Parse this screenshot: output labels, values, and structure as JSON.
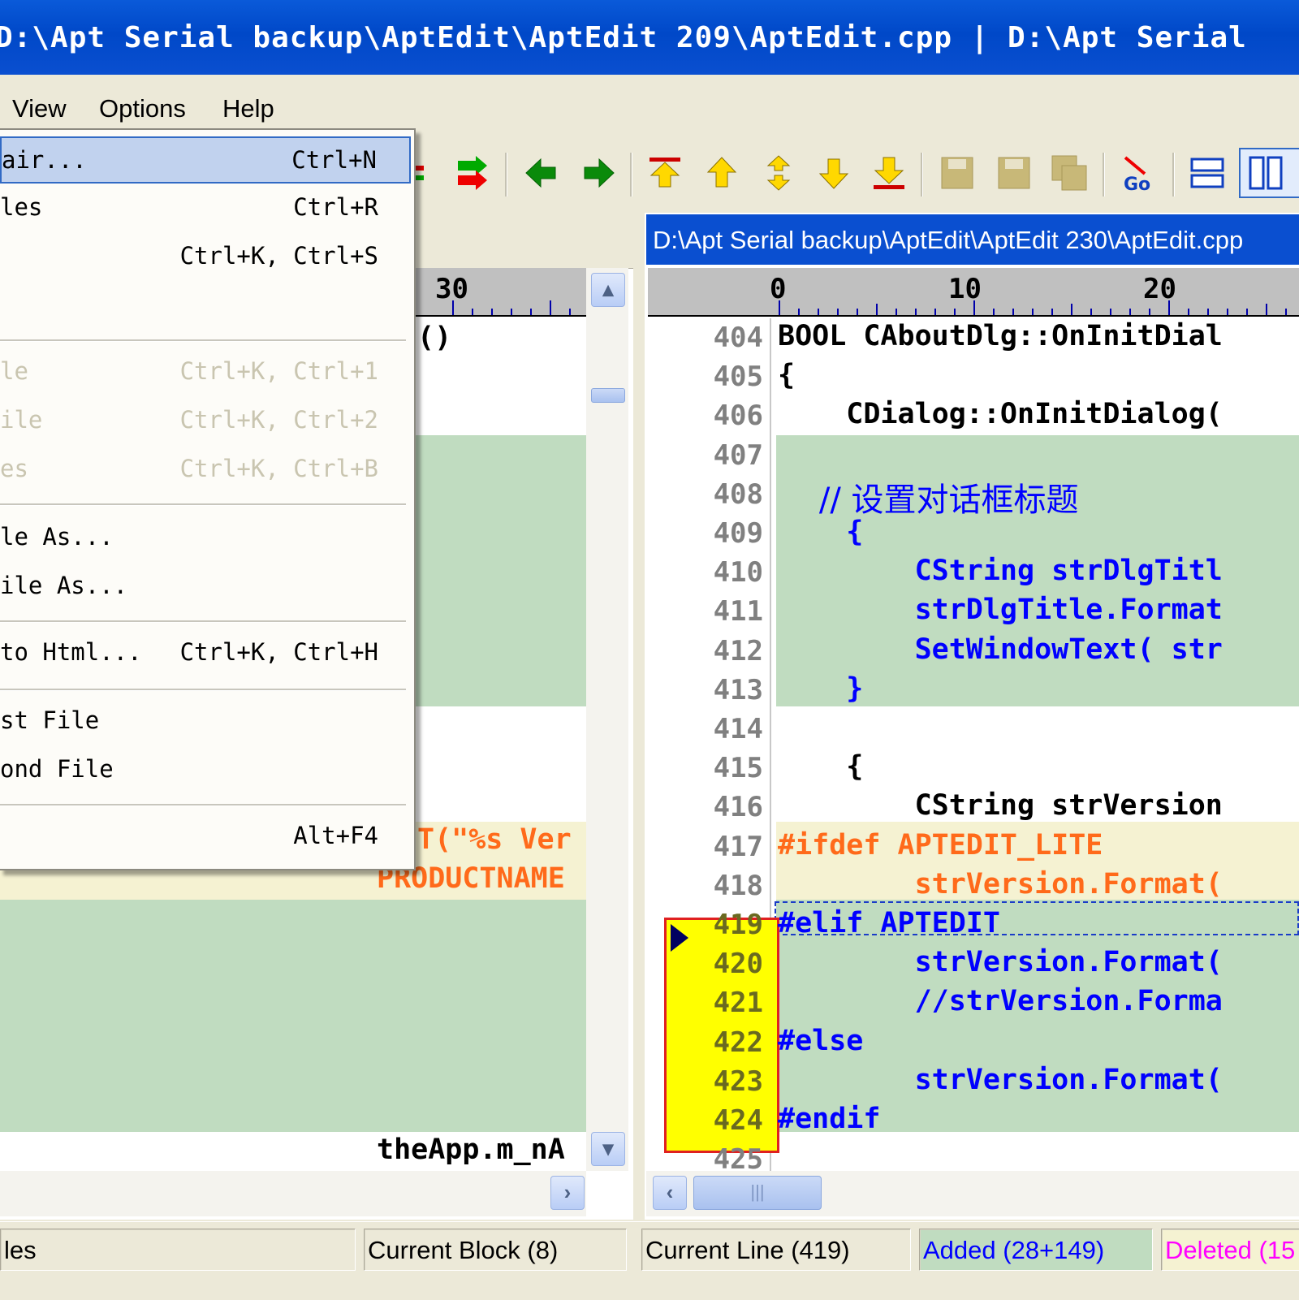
{
  "title_bar": {
    "text": "D:\\Apt Serial backup\\AptEdit\\AptEdit 209\\AptEdit.cpp | D:\\Apt Serial"
  },
  "menu": {
    "view": "View",
    "options": "Options",
    "help": "Help"
  },
  "dropdown": {
    "items": [
      {
        "label": "air...",
        "shortcut": "Ctrl+N",
        "enabled": true,
        "selected": true
      },
      {
        "label": "les",
        "shortcut": "Ctrl+R",
        "enabled": true
      },
      {
        "label": "",
        "shortcut": "Ctrl+K, Ctrl+S",
        "enabled": true
      },
      {
        "label": "le",
        "shortcut": "Ctrl+K, Ctrl+1",
        "enabled": false
      },
      {
        "label": "ile",
        "shortcut": "Ctrl+K, Ctrl+2",
        "enabled": false
      },
      {
        "label": "es",
        "shortcut": "Ctrl+K, Ctrl+B",
        "enabled": false
      },
      {
        "label": "le As...",
        "shortcut": "",
        "enabled": true
      },
      {
        "label": "ile As...",
        "shortcut": "",
        "enabled": true
      },
      {
        "label": "to Html...",
        "shortcut": "Ctrl+K, Ctrl+H",
        "enabled": true
      },
      {
        "label": "st File",
        "shortcut": "",
        "enabled": true
      },
      {
        "label": "ond File",
        "shortcut": "",
        "enabled": true
      },
      {
        "label": "",
        "shortcut": "Alt+F4",
        "enabled": true
      }
    ]
  },
  "toolbar": {
    "icons": [
      "red-green-arrow-icon",
      "arrow-left-icon",
      "arrow-right-icon",
      "first-diff-icon",
      "prev-diff-icon",
      "current-diff-icon",
      "next-diff-icon",
      "last-diff-icon",
      "save-left-icon",
      "save-right-icon",
      "save-both-icon",
      "goto-icon",
      "horizontal-layout-icon",
      "vertical-layout-icon"
    ]
  },
  "left_pane": {
    "ruler_label": "30",
    "fragments": {
      "paren": "()",
      "fmt_line": "T(\"%s Ver",
      "product": "PRODUCTNAME",
      "theapp": "theApp.m_nA"
    }
  },
  "right_pane": {
    "title": "D:\\Apt Serial backup\\AptEdit\\AptEdit 230\\AptEdit.cpp",
    "ruler_labels": [
      "0",
      "10",
      "20"
    ],
    "lines": [
      {
        "n": "404",
        "text": "BOOL CAboutDlg::OnInitDial"
      },
      {
        "n": "405",
        "text": "{"
      },
      {
        "n": "406",
        "text": "    CDialog::OnInitDialog("
      },
      {
        "n": "407",
        "text": ""
      },
      {
        "n": "408",
        "text": "    // 设置对话框标题"
      },
      {
        "n": "409",
        "text": "    {"
      },
      {
        "n": "410",
        "text": "        CString strDlgTitl"
      },
      {
        "n": "411",
        "text": "        strDlgTitle.Format"
      },
      {
        "n": "412",
        "text": "        SetWindowText( str"
      },
      {
        "n": "413",
        "text": "    }"
      },
      {
        "n": "414",
        "text": ""
      },
      {
        "n": "415",
        "text": "    {"
      },
      {
        "n": "416",
        "text": "        CString strVersion"
      },
      {
        "n": "417",
        "text": "#ifdef APTEDIT_LITE"
      },
      {
        "n": "418",
        "text": "        strVersion.Format("
      },
      {
        "n": "419",
        "text": "#elif APTEDIT"
      },
      {
        "n": "420",
        "text": "        strVersion.Format("
      },
      {
        "n": "421",
        "text": "        //strVersion.Forma"
      },
      {
        "n": "422",
        "text": "#else"
      },
      {
        "n": "423",
        "text": "        strVersion.Format("
      },
      {
        "n": "424",
        "text": "#endif"
      },
      {
        "n": "425",
        "text": ""
      }
    ]
  },
  "status_bar": {
    "files": "les",
    "block": "Current Block (8)",
    "line": "Current Line (419)",
    "added": "Added (28+149)",
    "deleted": "Deleted (15"
  },
  "colors": {
    "added_bg": "#c0dcc0",
    "changed_bg": "#f5f2d2",
    "current_block": "#ffff00",
    "added_text": "#0000ff",
    "changed_text": "#ff6a1a",
    "deleted_text": "#ff00ff"
  }
}
